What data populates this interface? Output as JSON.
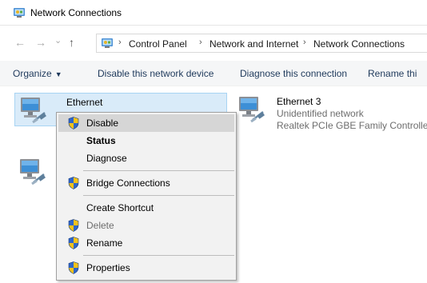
{
  "window": {
    "title": "Network Connections"
  },
  "address": {
    "back": "←",
    "forward": "→",
    "recent": "⌄",
    "up": "↑",
    "sep": "›",
    "crumbs": [
      "Control Panel",
      "Network and Internet",
      "Network Connections"
    ]
  },
  "commands": {
    "organize": "Organize",
    "organize_arrow": "▼",
    "disable": "Disable this network device",
    "diagnose": "Diagnose this connection",
    "rename": "Rename thi"
  },
  "items": [
    {
      "name": "Ethernet",
      "line1": "",
      "line2": ""
    },
    {
      "name": "Ethernet 3",
      "line1": "Unidentified network",
      "line2": "Realtek PCIe GBE Family Controlle"
    }
  ],
  "context_menu": {
    "disable": "Disable",
    "status": "Status",
    "diagnose": "Diagnose",
    "bridge": "Bridge Connections",
    "shortcut": "Create Shortcut",
    "delete": "Delete",
    "rename": "Rename",
    "properties": "Properties"
  },
  "colors": {
    "selection_bg": "#d9ebf9",
    "selection_border": "#a8d4f3",
    "menu_bg": "#f2f2f2",
    "menu_highlight": "#d6d6d6",
    "shield_blue": "#2f66c9",
    "shield_gold": "#f3c21a"
  }
}
